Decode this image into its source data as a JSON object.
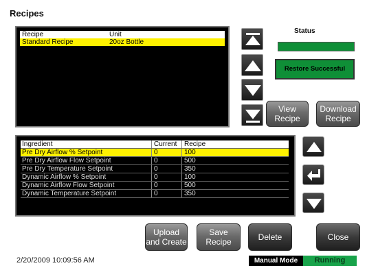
{
  "title": "Recipes",
  "recipe_list": {
    "columns": [
      "Recipe",
      "Unit"
    ],
    "rows": [
      {
        "recipe": "Standard Recipe",
        "unit": "20oz Bottle"
      }
    ]
  },
  "status": {
    "label": "Status",
    "message": "Restore Successful",
    "color": "#0f8f37"
  },
  "buttons": {
    "view_recipe_1": "View",
    "view_recipe_2": "Recipe",
    "download_recipe_1": "Download",
    "download_recipe_2": "Recipe",
    "upload_1": "Upload",
    "upload_2": "and Create",
    "save_1": "Save",
    "save_2": "Recipe",
    "delete": "Delete",
    "close": "Close"
  },
  "ingredients": {
    "columns": [
      "Ingredient",
      "Current",
      "Recipe"
    ],
    "rows": [
      {
        "ingredient": "Pre Dry Airflow % Setpoint",
        "current": "0",
        "recipe": "100"
      },
      {
        "ingredient": "Pre Dry Airflow Flow Setpoint",
        "current": "0",
        "recipe": "500"
      },
      {
        "ingredient": "Pre Dry Temperature Setpoint",
        "current": "0",
        "recipe": "350"
      },
      {
        "ingredient": "Dynamic Airflow % Setpoint",
        "current": "0",
        "recipe": "100"
      },
      {
        "ingredient": "Dynamic Airflow Flow Setpoint",
        "current": "0",
        "recipe": "500"
      },
      {
        "ingredient": "Dynamic Temperature Setpoint",
        "current": "0",
        "recipe": "350"
      }
    ]
  },
  "footer": {
    "timestamp": "2/20/2009 10:09:56 AM",
    "mode": "Manual Mode",
    "state": "Running",
    "state_color": "#18a34a"
  }
}
